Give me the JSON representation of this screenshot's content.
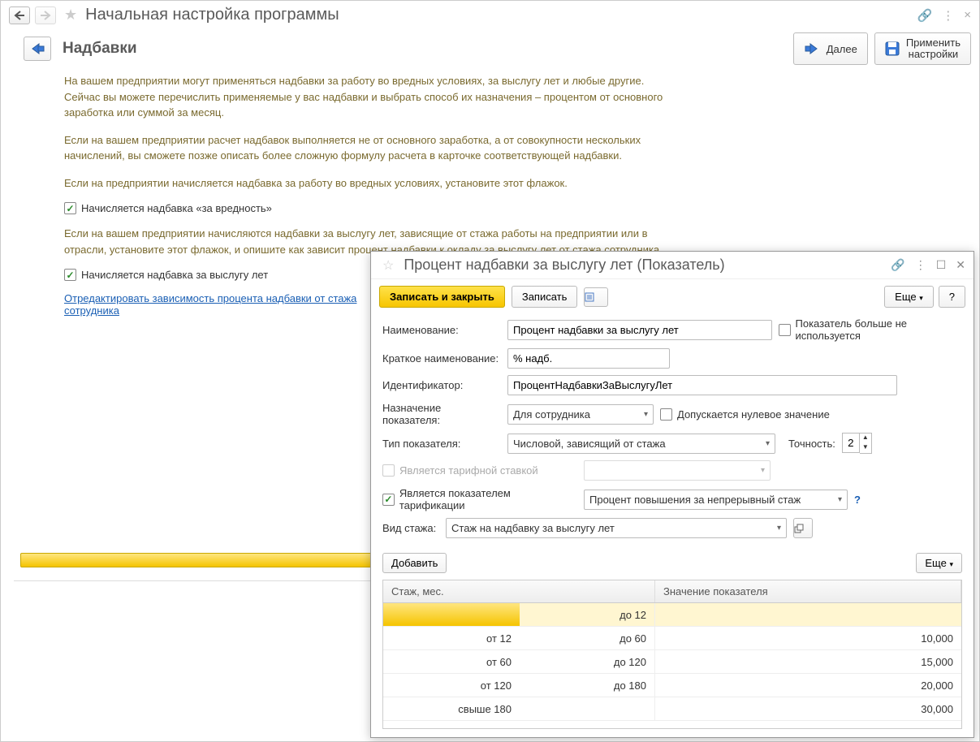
{
  "main": {
    "title": "Начальная настройка программы",
    "section_title": "Надбавки",
    "next_label": "Далее",
    "apply_label": "Применить\nнастройки",
    "para1": "На вашем предприятии могут применяться надбавки за работу во вредных условиях, за выслугу лет и любые другие. Сейчас вы можете перечислить применяемые у вас надбавки и выбрать способ их назначения – процентом от основного заработка или суммой за месяц.",
    "para2": "Если на вашем предприятии расчет надбавок выполняется не от основного заработка, а от  совокупности нескольких начислений, вы сможете позже описать более сложную формулу расчета в карточке соответствующей надбавки.",
    "para3": "Если на предприятии начисляется надбавка за работу во вредных условиях, установите этот флажок.",
    "chk1_label": "Начисляется надбавка «за вредность»",
    "para4": "Если на вашем предприятии начисляются надбавки за выслугу лет, зависящие от стажа работы на предприятии или в отрасли, установите этот флажок, и опишите как зависит процент надбавки к окладу за выслугу лет от стажа сотрудника.",
    "chk2_label": "Начисляется надбавка за выслугу лет",
    "link_text": "Отредактировать зависимость процента надбавки от стажа сотрудника"
  },
  "dialog": {
    "title": "Процент надбавки за выслугу лет (Показатель)",
    "save_close": "Записать и закрыть",
    "save": "Записать",
    "more": "Еще",
    "help": "?",
    "name_label": "Наименование:",
    "name_value": "Процент надбавки за выслугу лет",
    "unused_label": "Показатель больше не используется",
    "short_label": "Краткое наименование:",
    "short_value": "% надб.",
    "id_label": "Идентификатор:",
    "id_value": "ПроцентНадбавкиЗаВыслугуЛет",
    "purpose_label": "Назначение показателя:",
    "purpose_value": "Для сотрудника",
    "allow_zero_label": "Допускается нулевое значение",
    "type_label": "Тип показателя:",
    "type_value": "Числовой, зависящий от стажа",
    "precision_label": "Точность:",
    "precision_value": "2",
    "is_rate_label": "Является тарифной ставкой",
    "is_tarif_label": "Является показателем тарификации",
    "tarif_value": "Процент повышения за непрерывный стаж",
    "stage_type_label": "Вид стажа:",
    "stage_type_value": "Стаж на надбавку за выслугу лет",
    "add_btn": "Добавить",
    "col_stage": "Стаж, мес.",
    "col_value": "Значение показателя",
    "rows": [
      {
        "from": "",
        "to": "до 12",
        "val": ""
      },
      {
        "from": "от 12",
        "to": "до 60",
        "val": "10,000"
      },
      {
        "from": "от 60",
        "to": "до 120",
        "val": "15,000"
      },
      {
        "from": "от 120",
        "to": "до 180",
        "val": "20,000"
      },
      {
        "from": "свыше 180",
        "to": "",
        "val": "30,000"
      }
    ]
  }
}
